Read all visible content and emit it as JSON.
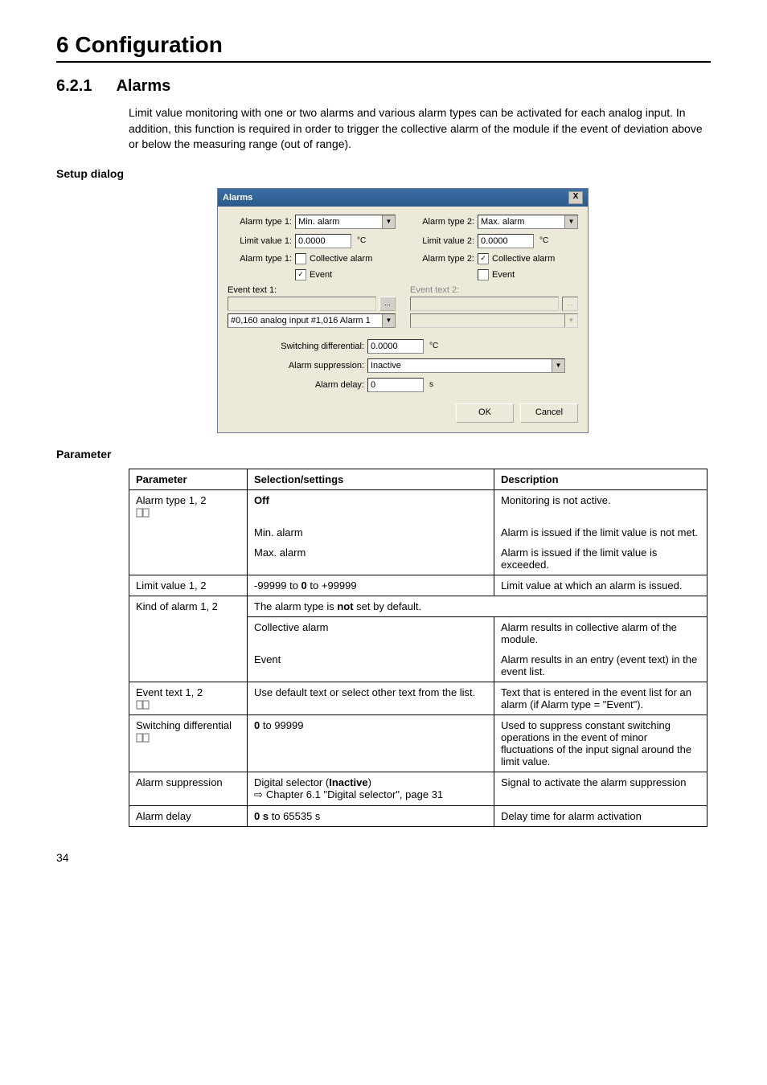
{
  "chapter_title": "6 Configuration",
  "section_num": "6.2.1",
  "section_title": "Alarms",
  "intro_text": "Limit value monitoring with one or two alarms and various alarm types can be activated for each analog input. In addition, this function is required in order to trigger the collective alarm of the module if the event of deviation above or below the measuring range (out of range).",
  "setup_dialog_label": "Setup dialog",
  "parameter_section_label": "Parameter",
  "page_number": "34",
  "dialog": {
    "title": "Alarms",
    "close": "X",
    "alarm_type_1_label": "Alarm type 1:",
    "alarm_type_1_value": "Min. alarm",
    "limit_value_1_label": "Limit value 1:",
    "limit_value_1_value": "0.0000",
    "unit_1": "°C",
    "alarm_type_1b_label": "Alarm type 1:",
    "collective_alarm_1": "Collective alarm",
    "event_1": "Event",
    "event_text_1_label": "Event text 1:",
    "event_text_1_value": "#0,160 analog input #1,016 Alarm 1",
    "ellipsis": "...",
    "alarm_type_2_label": "Alarm type 2:",
    "alarm_type_2_value": "Max. alarm",
    "limit_value_2_label": "Limit value 2:",
    "limit_value_2_value": "0.0000",
    "unit_2": "°C",
    "alarm_type_2b_label": "Alarm type 2:",
    "collective_alarm_2": "Collective alarm",
    "event_2": "Event",
    "event_text_2_label": "Event text 2:",
    "switching_diff_label": "Switching differential:",
    "switching_diff_value": "0.0000",
    "switching_diff_unit": "°C",
    "alarm_suppression_label": "Alarm suppression:",
    "alarm_suppression_value": "Inactive",
    "alarm_delay_label": "Alarm delay:",
    "alarm_delay_value": "0",
    "alarm_delay_unit": "s",
    "ok": "OK",
    "cancel": "Cancel"
  },
  "table": {
    "headers": {
      "p": "Parameter",
      "s": "Selection/settings",
      "d": "Description"
    },
    "rows": {
      "alarm_type": {
        "p": "Alarm type 1, 2",
        "s_off": "Off",
        "s_min": "Min. alarm",
        "s_max": "Max. alarm",
        "d_off": "Monitoring is not active.",
        "d_min": "Alarm is issued if the limit value is not met.",
        "d_max": "Alarm is issued if the limit value is exceeded."
      },
      "limit_value": {
        "p": "Limit value 1, 2",
        "s_pre": "-99999 to ",
        "s_bold": "0",
        "s_post": " to +99999",
        "d": "Limit value at which an alarm is issued."
      },
      "kind": {
        "p": "Kind of alarm 1, 2",
        "span_pre": "The alarm type is ",
        "span_bold": "not",
        "span_post": " set by default.",
        "s_collective": "Collective alarm",
        "d_collective": "Alarm results in collective alarm of the module.",
        "s_event": "Event",
        "d_event": "Alarm results in an entry (event text) in the event list."
      },
      "event_text": {
        "p": "Event text 1, 2",
        "s": "Use default text or select other text from the list.",
        "d": "Text that is entered in the event list for an alarm (if Alarm type = \"Event\")."
      },
      "switching_diff": {
        "p": "Switching differential",
        "s_bold": "0",
        "s_post": " to 99999",
        "d": "Used to suppress constant switching operations in the event of minor fluctuations of the input signal around the limit value."
      },
      "alarm_suppression": {
        "p": "Alarm suppression",
        "s_pre": "Digital selector (",
        "s_bold": "Inactive",
        "s_post": ")",
        "s_ref": "Chapter 6.1 \"Digital selector\", page 31",
        "d": "Signal to activate the alarm suppression"
      },
      "alarm_delay": {
        "p": "Alarm delay",
        "s_bold": "0 s",
        "s_post": " to 65535 s",
        "d": "Delay time for alarm activation"
      }
    }
  }
}
